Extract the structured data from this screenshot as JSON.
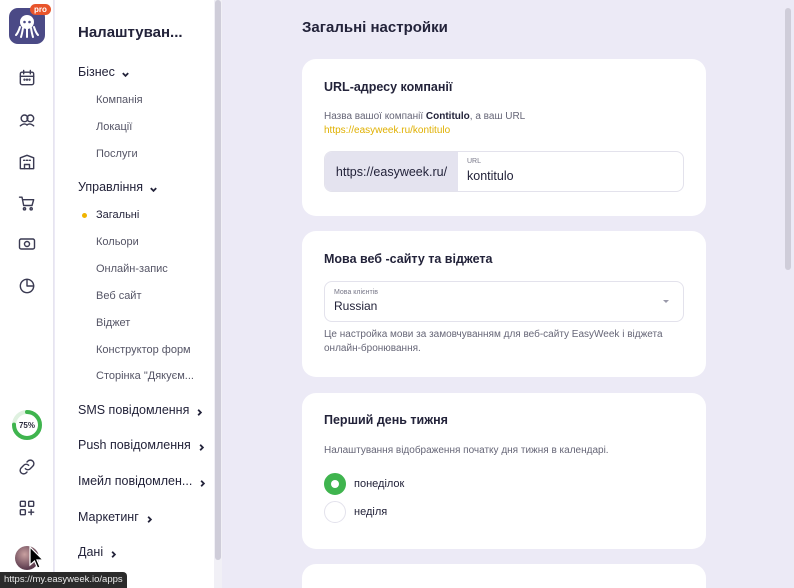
{
  "app": {
    "badge": "pro",
    "progress_label": "75%",
    "progress_value": 0.75
  },
  "rail": {
    "icons": [
      "calendar-icon",
      "clients-icon",
      "building-icon",
      "cart-icon",
      "money-icon",
      "chart-pie-icon",
      "link-icon",
      "apps-add-icon"
    ]
  },
  "menu": {
    "title": "Налаштуван...",
    "groups": {
      "business": "Бізнес",
      "management": "Управління",
      "sms": "SMS повідомлення",
      "push": "Push повідомлення",
      "email": "Імейл повідомлен...",
      "marketing": "Маркетинг",
      "data": "Дані"
    },
    "business_items": [
      "Компанія",
      "Локації",
      "Послуги"
    ],
    "management_items": [
      "Загальні",
      "Кольори",
      "Онлайн-запис",
      "Веб сайт",
      "Віджет",
      "Конструктор форм",
      "Сторінка \"Дякуєм..."
    ]
  },
  "main": {
    "page_title": "Загальні настройки",
    "url_card": {
      "title": "URL-адресу компанії",
      "desc_prefix": "Назва вашої компанії ",
      "company": "Contitulo",
      "desc_suffix": ", а ваш URL",
      "link": "https://easyweek.ru/kontitulo",
      "prefix": "https://easyweek.ru/",
      "input_label": "URL",
      "input_value": "kontitulo"
    },
    "lang_card": {
      "title": "Мова веб -сайту та віджета",
      "select_label": "Мова клієнтів",
      "select_value": "Russian",
      "desc": "Це настройка мови за замовчуванням для веб-сайту EasyWeek і віджета онлайн-бронювання."
    },
    "week_card": {
      "title": "Перший день тижня",
      "desc": "Налаштування відображення початку дня тижня в календарі.",
      "options": [
        "понеділок",
        "неділя"
      ],
      "selected": "понеділок"
    }
  },
  "status_bar": {
    "url": "https://my.easyweek.io/apps"
  },
  "colors": {
    "accent_green": "#3fb44e",
    "link_yellow": "#e0b000",
    "pro_badge": "#e8542b",
    "logo_bg": "#4b4a86"
  }
}
